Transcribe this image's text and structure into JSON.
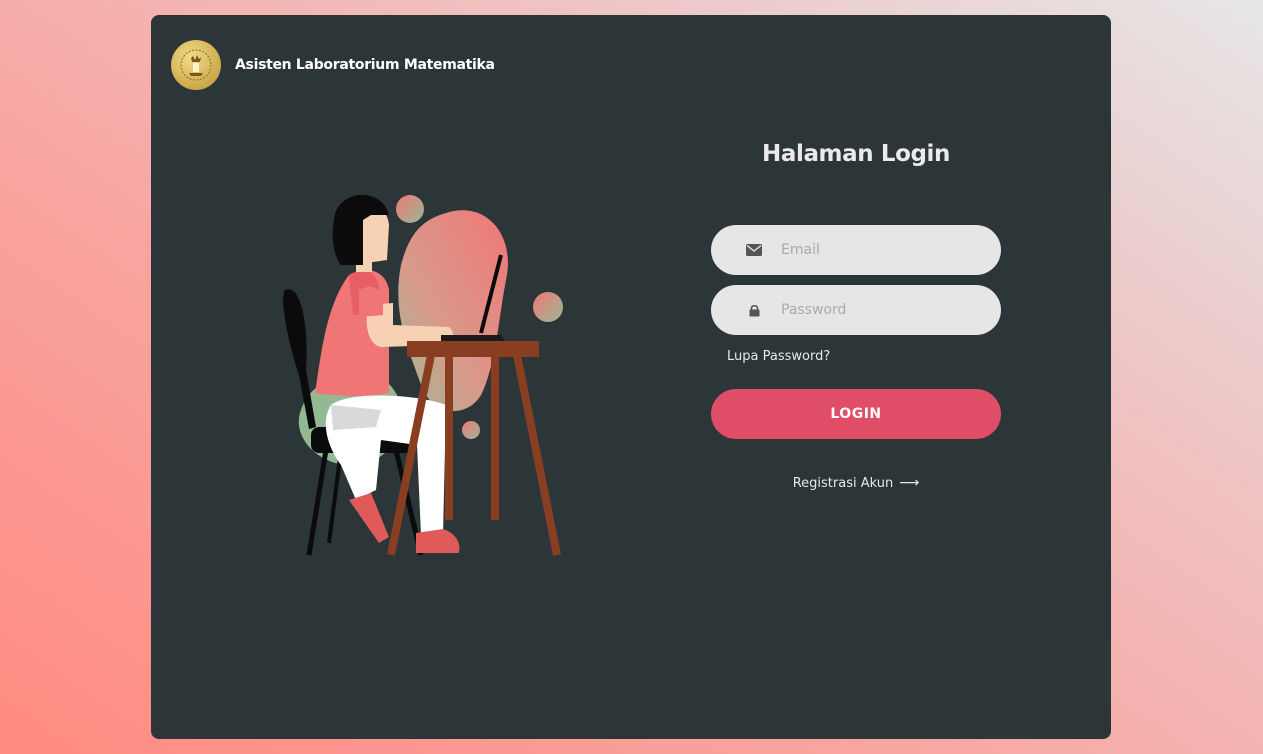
{
  "header": {
    "app_title": "Asisten Laboratorium Matematika",
    "logo_icon": "university-seal-icon"
  },
  "login": {
    "title": "Halaman Login",
    "email": {
      "placeholder": "Email",
      "value": "",
      "icon": "envelope-icon"
    },
    "password": {
      "placeholder": "Password",
      "value": "",
      "icon": "lock-icon"
    },
    "forgot_label": "Lupa Password?",
    "submit_label": "LOGIN",
    "register_label": "Registrasi Akun",
    "register_icon": "arrow-right-icon"
  },
  "colors": {
    "page_bg_start": "#ff8a80",
    "page_bg_end": "#e6e6e6",
    "card_bg": "#2c3538",
    "accent": "#e04d66",
    "input_bg": "#e6e6e6"
  }
}
